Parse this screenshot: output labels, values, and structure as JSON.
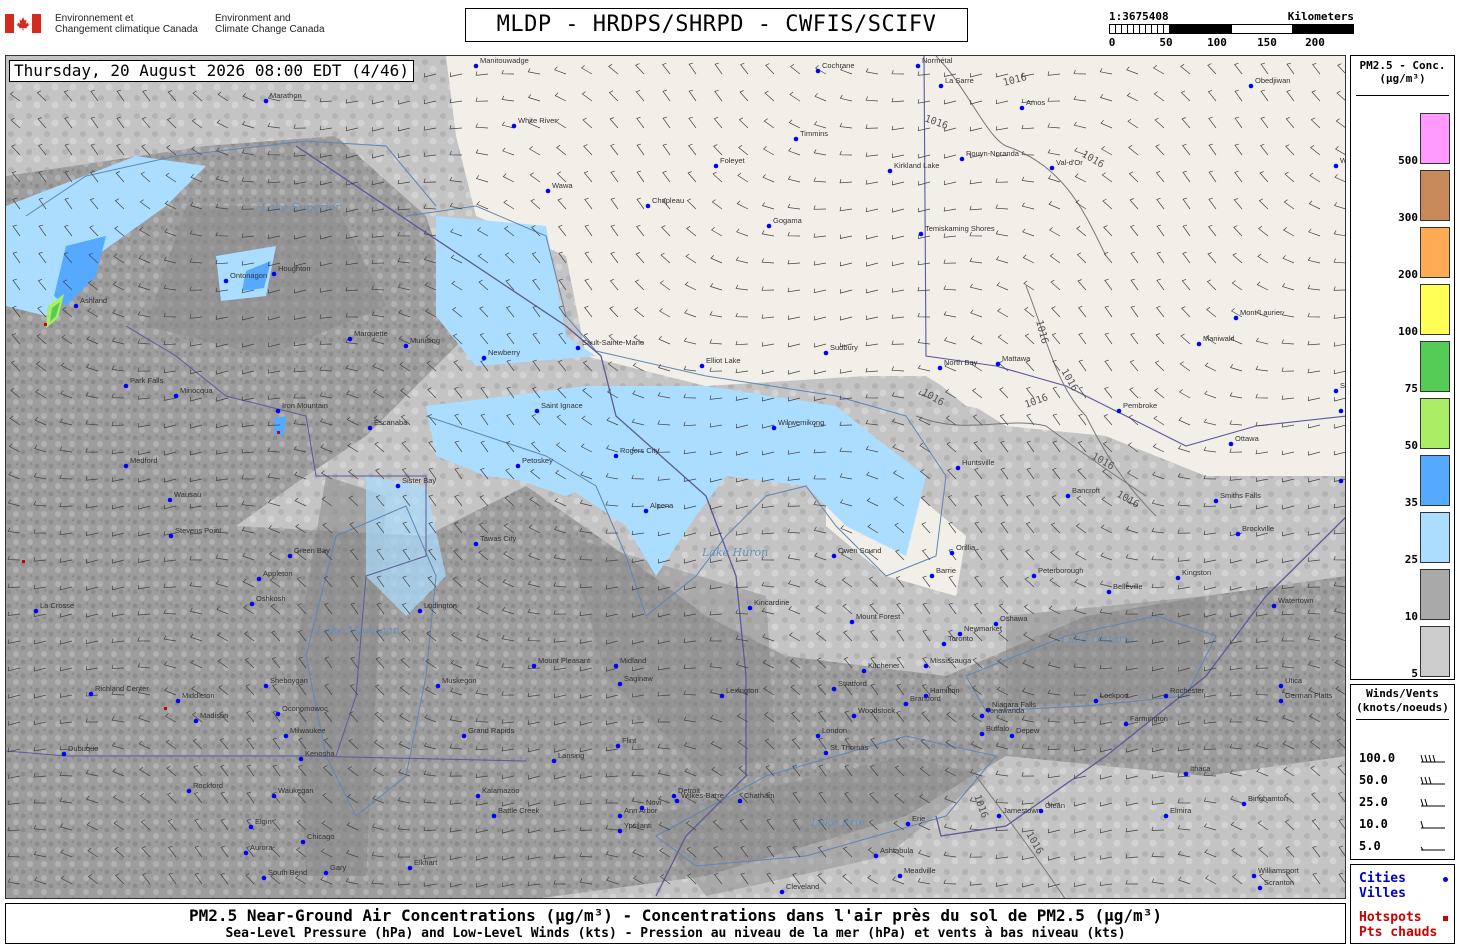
{
  "header": {
    "agency_fr_line1": "Environnement et",
    "agency_fr_line2": "Changement climatique Canada",
    "agency_en_line1": "Environment and",
    "agency_en_line2": "Climate Change Canada",
    "title": "MLDP - HRDPS/SHRPD - CWFIS/SCIFV"
  },
  "scale": {
    "ratio": "1:3675408",
    "units": "Kilometers",
    "labels": [
      "0",
      "50",
      "100",
      "150",
      "200"
    ]
  },
  "map": {
    "timestamp": "Thursday, 20 August 2026 08:00 EDT (4/46)",
    "isobar_label": "1016",
    "lakes": [
      "Lake Superior",
      "Lake Huron",
      "Lake Michigan",
      "Lake Erie",
      "Lake Ontario"
    ],
    "cities": [
      "Manitouwadge",
      "Cochrane",
      "Normétal",
      "La Sarre",
      "Amos",
      "Obedjiwan",
      "Wemo",
      "White River",
      "Timmins",
      "Foleyet",
      "Kirkland Lake",
      "Rouyn-Noranda",
      "Val-d'Or",
      "Wawa",
      "Chapleau",
      "Gogama",
      "Temiskaming Shores",
      "Marathon",
      "Houghton",
      "Ontonagon",
      "Ashland",
      "Marquette",
      "Munising",
      "Newberry",
      "Sault-Sainte-Marie",
      "Elliot Lake",
      "Sudbury",
      "North Bay",
      "Mattawa",
      "Maniwaki",
      "Mont-Laurier",
      "Saint",
      "Mirabel",
      "Pembroke",
      "Ottawa",
      "Cornwall",
      "Park Falls",
      "Minocqua",
      "Iron Mountain",
      "Escanaba",
      "Saint Ignace",
      "Wikwemikong",
      "Huntsville",
      "Rogers City",
      "Medford",
      "Wausau",
      "Stevens Point",
      "Sister Bay",
      "Petoskey",
      "Alpena",
      "Bancroft",
      "Smiths Falls",
      "Brockville",
      "Green Bay",
      "Appleton",
      "Oshkosh",
      "Owen Sound",
      "Orillia",
      "Barrie",
      "Peterborough",
      "Belleville",
      "Kingston",
      "Watertown",
      "La Crosse",
      "Ludington",
      "Tawas City",
      "Kincardine",
      "Mount Forest",
      "Newmarket",
      "Toronto",
      "Mississauga",
      "Oshawa",
      "Mount Pleasant",
      "Midland",
      "Saginaw",
      "Richland Center",
      "Sheboygan",
      "Muskegon",
      "Stratford",
      "Kitchener",
      "Hamilton",
      "Niagara Falls",
      "Rochester",
      "Utica",
      "German Flatts",
      "Middleton",
      "Madison",
      "Oconomowoc",
      "Milwaukee",
      "Lexington",
      "Woodstock",
      "Brantford",
      "Tonawanda",
      "Buffalo",
      "Depew",
      "Lockport",
      "Farmington",
      "Dubuque",
      "Kenosha",
      "Grand Rapids",
      "Flint",
      "London",
      "St. Thomas",
      "Ithaca",
      "Binghamton",
      "Rockford",
      "Waukegan",
      "Kalamazoo",
      "Battle Creek",
      "Lansing",
      "Ann Arbor",
      "Detroit",
      "Chatham",
      "Jamestown",
      "Elmira",
      "Olean",
      "Erie",
      "Elgin",
      "Aurora",
      "Chicago",
      "Gary",
      "South Bend",
      "Elkhart",
      "Michigan City",
      "Ypsilanti",
      "Novi",
      "Ashtabula",
      "Meadville",
      "Cleveland",
      "Williamsport",
      "Scranton",
      "Wilkes-Barre",
      "Toledo"
    ]
  },
  "legend": {
    "conc_title_1": "PM2.5 - Conc.",
    "conc_title_2": "(µg/m³)",
    "conc_levels": [
      {
        "label": "500",
        "color": "#ff99ff"
      },
      {
        "label": "300",
        "color": "#c8895a"
      },
      {
        "label": "200",
        "color": "#ffaa55"
      },
      {
        "label": "100",
        "color": "#ffff55"
      },
      {
        "label": "75",
        "color": "#55cc55"
      },
      {
        "label": "50",
        "color": "#aaee66"
      },
      {
        "label": "35",
        "color": "#55aaff"
      },
      {
        "label": "25",
        "color": "#aaddff"
      },
      {
        "label": "10",
        "color": "#a9a9a9"
      },
      {
        "label": "5",
        "color": "#cccccc"
      }
    ],
    "wind_title_1": "Winds/Vents",
    "wind_title_2": "(knots/noeuds)",
    "wind_levels": [
      "100.0",
      "50.0",
      "25.0",
      "10.0",
      "5.0"
    ],
    "cities_en": "Cities",
    "cities_fr": "Villes",
    "hotspots_en": "Hotspots",
    "hotspots_fr": "Pts chauds",
    "city_color": "#0000ff",
    "hotspot_color": "#cc0000"
  },
  "footer": {
    "line1": "PM2.5 Near-Ground Air Concentrations (µg/m³) - Concentrations dans l'air près du sol de PM2.5 (µg/m³)",
    "line2": "Sea-Level Pressure (hPa) and Low-Level Winds (kts) - Pression au niveau de la mer (hPa) et vents à bas niveau (kts)"
  }
}
